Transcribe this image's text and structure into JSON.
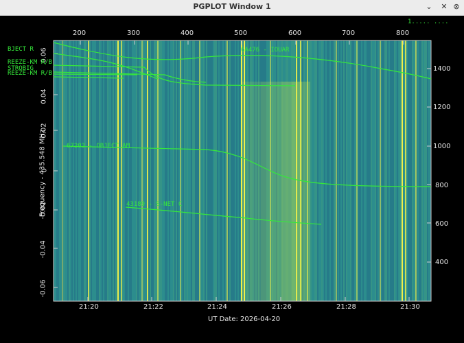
{
  "window": {
    "title": "PGPLOT Window 1",
    "buttons": {
      "minimize": "⌄",
      "close": "✕"
    }
  },
  "plot": {
    "x_label": "UT Date: 2026-04-20",
    "y_label": "Frequency - 435.548 MHz",
    "top_axis_ticks": [
      "200",
      "300",
      "400",
      "500",
      "600",
      "700",
      "800"
    ],
    "bottom_axis_ticks": [
      "21:20",
      "21:22",
      "21:24",
      "21:26",
      "21:28",
      "21:30"
    ],
    "left_axis_ticks": [
      "0.06",
      "0.04",
      "0.02",
      "0",
      "-0.02",
      "-0.04",
      "-0.06"
    ],
    "right_axis_ticks": [
      "1400",
      "1200",
      "1000",
      "800",
      "600",
      "400"
    ],
    "corner_text_top_right": "1.....    ....",
    "satellite_labels": [
      "BJECT R",
      "6A476 - IOUAR",
      "REEZE-KM R/B",
      "STROBIG",
      "REEZE-KM R/B",
      "67203 - OBJECT AM",
      "43189 - S-NET C"
    ],
    "colors": {
      "background": "#000000",
      "waterfall_base": "#2f8a8c",
      "bright": "#f0f04a",
      "track": "#35e83a"
    }
  }
}
